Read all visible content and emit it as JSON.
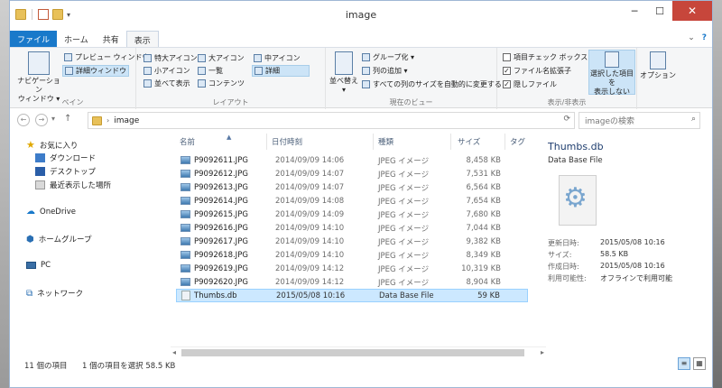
{
  "window": {
    "title": "image",
    "controls": {
      "minimize": "─",
      "maximize": "☐",
      "close": "✕"
    }
  },
  "ribbon_tabs": [
    {
      "label": "ファイル"
    },
    {
      "label": "ホーム"
    },
    {
      "label": "共有"
    },
    {
      "label": "表示"
    }
  ],
  "tabs_right": {
    "collapse": "⌄",
    "help": "?"
  },
  "ribbon": {
    "pane": {
      "label": "ペイン",
      "nav_pane_line1": "ナビゲーション",
      "nav_pane_line2": "ウィンドウ ▾",
      "preview": "プレビュー ウィンドウ",
      "details": "詳細ウィンドウ"
    },
    "layout": {
      "label": "レイアウト",
      "items": [
        "特大アイコン",
        "大アイコン",
        "中アイコン",
        "小アイコン",
        "一覧",
        "詳細",
        "並べて表示",
        "コンテンツ"
      ]
    },
    "current_view": {
      "label": "現在のビュー",
      "sort_line1": "並べ替え",
      "sort_line2": "▾",
      "group_by": "グループ化 ▾",
      "add_columns": "列の追加 ▾",
      "fit_columns": "すべての列のサイズを自動的に変更する"
    },
    "show_hide": {
      "label": "表示/非表示",
      "item_checkboxes": "項目チェック ボックス",
      "file_extensions": "ファイル名拡張子",
      "hidden_items": "隠しファイル",
      "hide_selected_line1": "選択した項目を",
      "hide_selected_line2": "表示しない",
      "options": "オプション"
    }
  },
  "navigation": {
    "back": "←",
    "forward": "→",
    "up": "↑",
    "path": "image",
    "search_placeholder": "imageの検索"
  },
  "nav_pane": {
    "favorites": "お気に入り",
    "downloads": "ダウンロード",
    "desktop": "デスクトップ",
    "recent": "最近表示した場所",
    "onedrive": "OneDrive",
    "homegroup": "ホームグループ",
    "pc": "PC",
    "network": "ネットワーク"
  },
  "columns": {
    "name": "名前",
    "date": "日付時刻",
    "type": "種類",
    "size": "サイズ",
    "tag": "タグ"
  },
  "files": [
    {
      "name": "P9092611.JPG",
      "date": "2014/09/09 14:06",
      "type": "JPEG イメージ",
      "size": "8,458 KB"
    },
    {
      "name": "P9092612.JPG",
      "date": "2014/09/09 14:07",
      "type": "JPEG イメージ",
      "size": "7,531 KB"
    },
    {
      "name": "P9092613.JPG",
      "date": "2014/09/09 14:07",
      "type": "JPEG イメージ",
      "size": "6,564 KB"
    },
    {
      "name": "P9092614.JPG",
      "date": "2014/09/09 14:08",
      "type": "JPEG イメージ",
      "size": "7,654 KB"
    },
    {
      "name": "P9092615.JPG",
      "date": "2014/09/09 14:09",
      "type": "JPEG イメージ",
      "size": "7,680 KB"
    },
    {
      "name": "P9092616.JPG",
      "date": "2014/09/09 14:10",
      "type": "JPEG イメージ",
      "size": "7,044 KB"
    },
    {
      "name": "P9092617.JPG",
      "date": "2014/09/09 14:10",
      "type": "JPEG イメージ",
      "size": "9,382 KB"
    },
    {
      "name": "P9092618.JPG",
      "date": "2014/09/09 14:10",
      "type": "JPEG イメージ",
      "size": "8,349 KB"
    },
    {
      "name": "P9092619.JPG",
      "date": "2014/09/09 14:12",
      "type": "JPEG イメージ",
      "size": "10,319 KB"
    },
    {
      "name": "P9092620.JPG",
      "date": "2014/09/09 14:12",
      "type": "JPEG イメージ",
      "size": "8,904 KB"
    },
    {
      "name": "Thumbs.db",
      "date": "2015/05/08 10:16",
      "type": "Data Base File",
      "size": "59 KB"
    }
  ],
  "details_pane": {
    "name": "Thumbs.db",
    "type": "Data Base File",
    "modified_label": "更新日時:",
    "modified": "2015/05/08 10:16",
    "size_label": "サイズ:",
    "size": "58.5 KB",
    "created_label": "作成日時:",
    "created": "2015/05/08 10:16",
    "availability_label": "利用可能性:",
    "availability": "オフラインで利用可能"
  },
  "status": {
    "item_count": "11 個の項目",
    "selected": "1 個の項目を選択  58.5 KB"
  },
  "colors": {
    "accent": "#1979ca",
    "selection": "#cce8ff"
  }
}
